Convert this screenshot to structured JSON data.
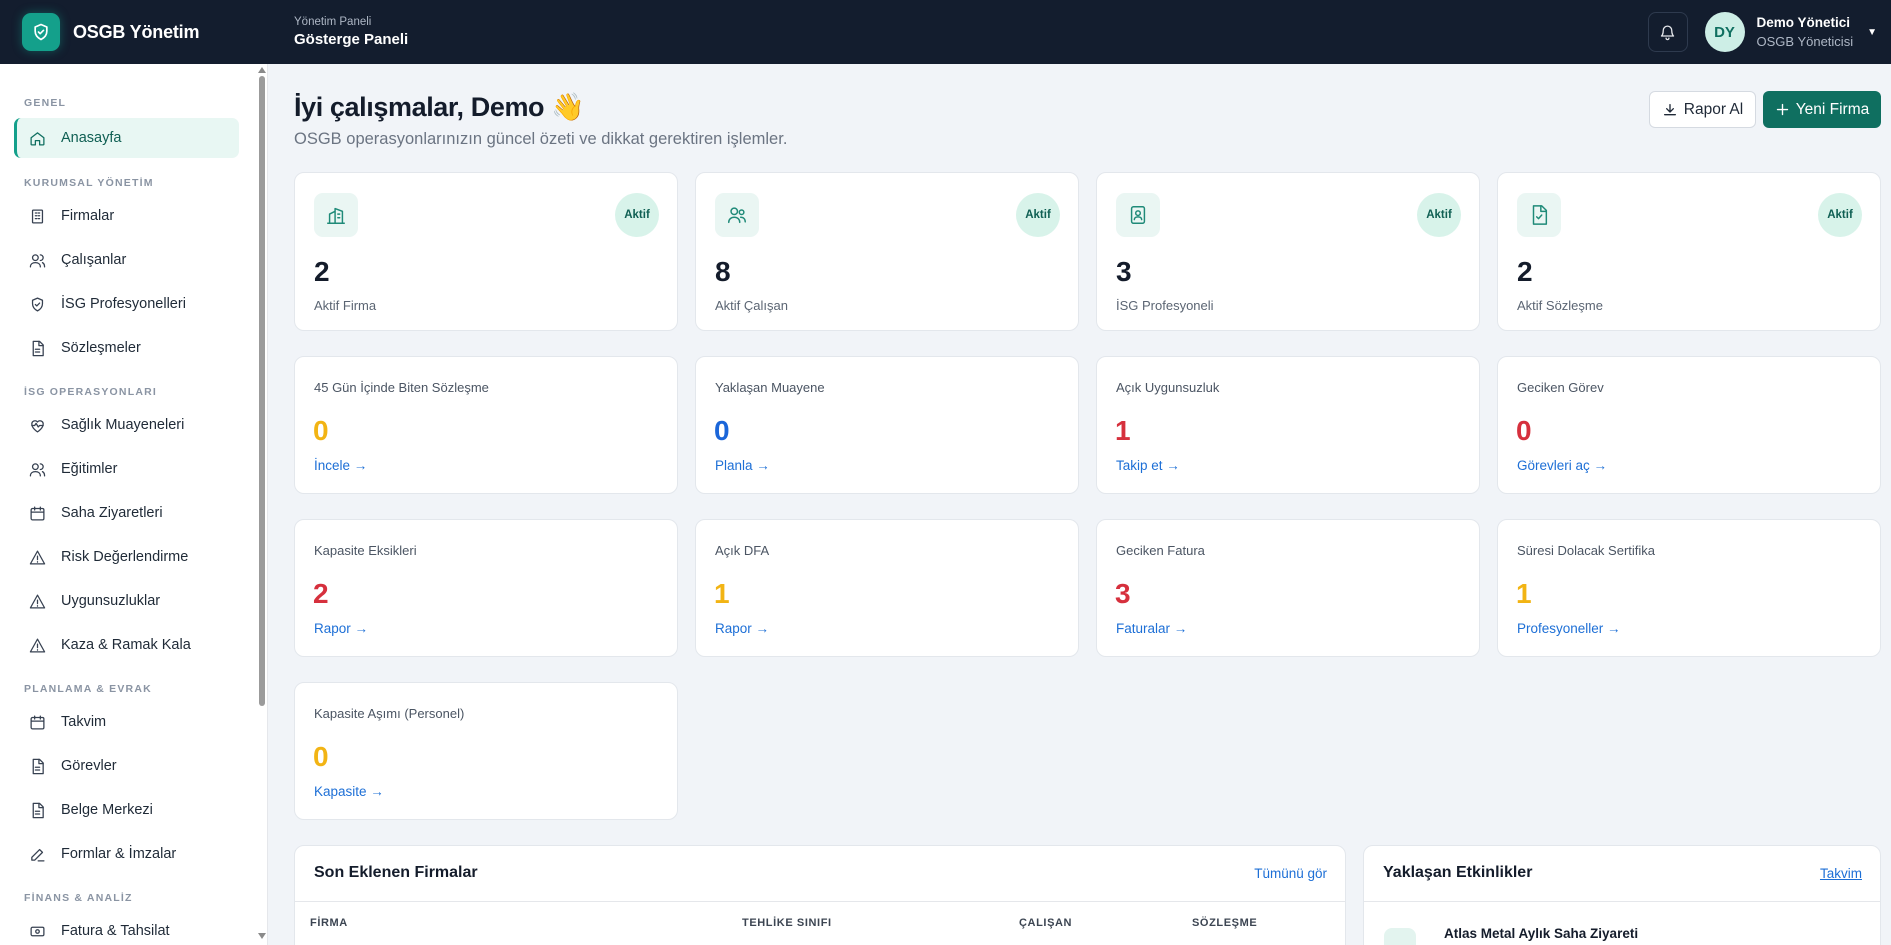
{
  "topbar": {
    "brand_name": "OSGB Yönetim",
    "breadcrumb_parent": "Yönetim Paneli",
    "breadcrumb_current": "Gösterge Paneli",
    "user_initials": "DY",
    "user_name": "Demo Yönetici",
    "user_role": "OSGB Yöneticisi"
  },
  "sidebar": {
    "sections": [
      "GENEL",
      "KURUMSAL YÖNETİM",
      "İSG OPERASYONLARI",
      "PLANLAMA & EVRAK",
      "FİNANS & ANALİZ"
    ],
    "items": [
      {
        "label": "Anasayfa",
        "icon": "home-icon",
        "active": true
      },
      {
        "label": "Firmalar",
        "icon": "building-icon"
      },
      {
        "label": "Çalışanlar",
        "icon": "users-icon"
      },
      {
        "label": "İSG Profesyonelleri",
        "icon": "shield-icon"
      },
      {
        "label": "Sözleşmeler",
        "icon": "document-icon"
      },
      {
        "label": "Sağlık Muayeneleri",
        "icon": "heart-pulse-icon"
      },
      {
        "label": "Eğitimler",
        "icon": "users-icon"
      },
      {
        "label": "Saha Ziyaretleri",
        "icon": "calendar-icon"
      },
      {
        "label": "Risk Değerlendirme",
        "icon": "warning-icon"
      },
      {
        "label": "Uygunsuzluklar",
        "icon": "warning-icon"
      },
      {
        "label": "Kaza & Ramak Kala",
        "icon": "warning-icon"
      },
      {
        "label": "Takvim",
        "icon": "calendar-icon"
      },
      {
        "label": "Görevler",
        "icon": "document-icon"
      },
      {
        "label": "Belge Merkezi",
        "icon": "document-icon"
      },
      {
        "label": "Formlar & İmzalar",
        "icon": "pen-icon"
      },
      {
        "label": "Fatura & Tahsilat",
        "icon": "invoice-icon"
      }
    ]
  },
  "header": {
    "greeting": "İyi çalışmalar, Demo 👋",
    "subtitle": "OSGB operasyonlarınızın güncel özeti ve dikkat gerektiren işlemler.",
    "report_button": "Rapor Al",
    "new_company_button": "Yeni Firma"
  },
  "stats": [
    {
      "value": "2",
      "label": "Aktif Firma",
      "badge": "Aktif",
      "icon": "building-icon"
    },
    {
      "value": "8",
      "label": "Aktif Çalışan",
      "badge": "Aktif",
      "icon": "users-icon"
    },
    {
      "value": "3",
      "label": "İSG Profesyoneli",
      "badge": "Aktif",
      "icon": "id-badge-icon"
    },
    {
      "value": "2",
      "label": "Aktif Sözleşme",
      "badge": "Aktif",
      "icon": "file-check-icon"
    }
  ],
  "alerts": [
    {
      "title": "45 Gün İçinde Biten Sözleşme",
      "value": "0",
      "link": "İncele →",
      "color": "#f2b414"
    },
    {
      "title": "Yaklaşan Muayene",
      "value": "0",
      "link": "Planla →",
      "color": "#1b66d9"
    },
    {
      "title": "Açık Uygunsuzluk",
      "value": "1",
      "link": "Takip et →",
      "color": "#d6303d"
    },
    {
      "title": "Geciken Görev",
      "value": "0",
      "link": "Görevleri aç →",
      "color": "#d6303d"
    },
    {
      "title": "Kapasite Eksikleri",
      "value": "2",
      "link": "Rapor →",
      "color": "#d6303d"
    },
    {
      "title": "Açık DFA",
      "value": "1",
      "link": "Rapor →",
      "color": "#f2b414"
    },
    {
      "title": "Geciken Fatura",
      "value": "3",
      "link": "Faturalar →",
      "color": "#d6303d"
    },
    {
      "title": "Süresi Dolacak Sertifika",
      "value": "1",
      "link": "Profesyoneller →",
      "color": "#f2b414"
    },
    {
      "title": "Kapasite Aşımı (Personel)",
      "value": "0",
      "link": "Kapasite →",
      "color": "#f2b414"
    }
  ],
  "recent_companies": {
    "title": "Son Eklenen Firmalar",
    "view_all": "Tümünü gör",
    "columns": [
      "FİRMA",
      "TEHLİKE SINIFI",
      "ÇALIŞAN",
      "SÖZLEŞME"
    ]
  },
  "upcoming_events": {
    "title": "Yaklaşan Etkinlikler",
    "calendar_link": "Takvim",
    "items": [
      {
        "title": "Atlas Metal Aylık Saha Ziyareti"
      }
    ]
  }
}
